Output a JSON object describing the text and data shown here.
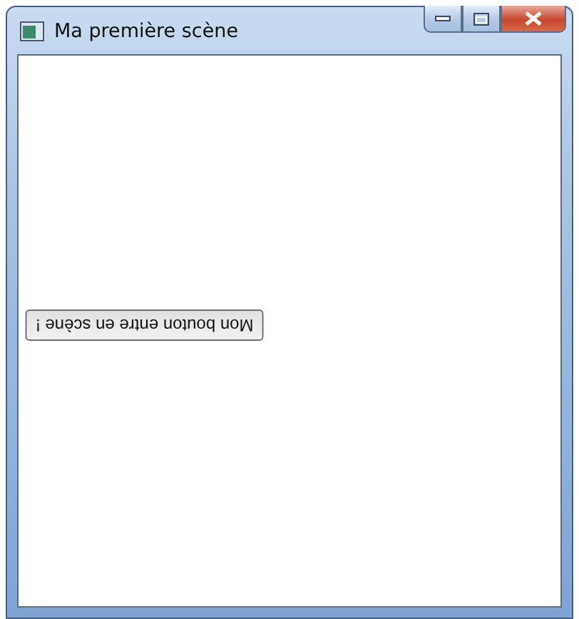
{
  "window": {
    "title": "Ma première scène"
  },
  "scene": {
    "button": {
      "label": "Mon bouton entre en scène !",
      "rotated": true
    }
  }
}
